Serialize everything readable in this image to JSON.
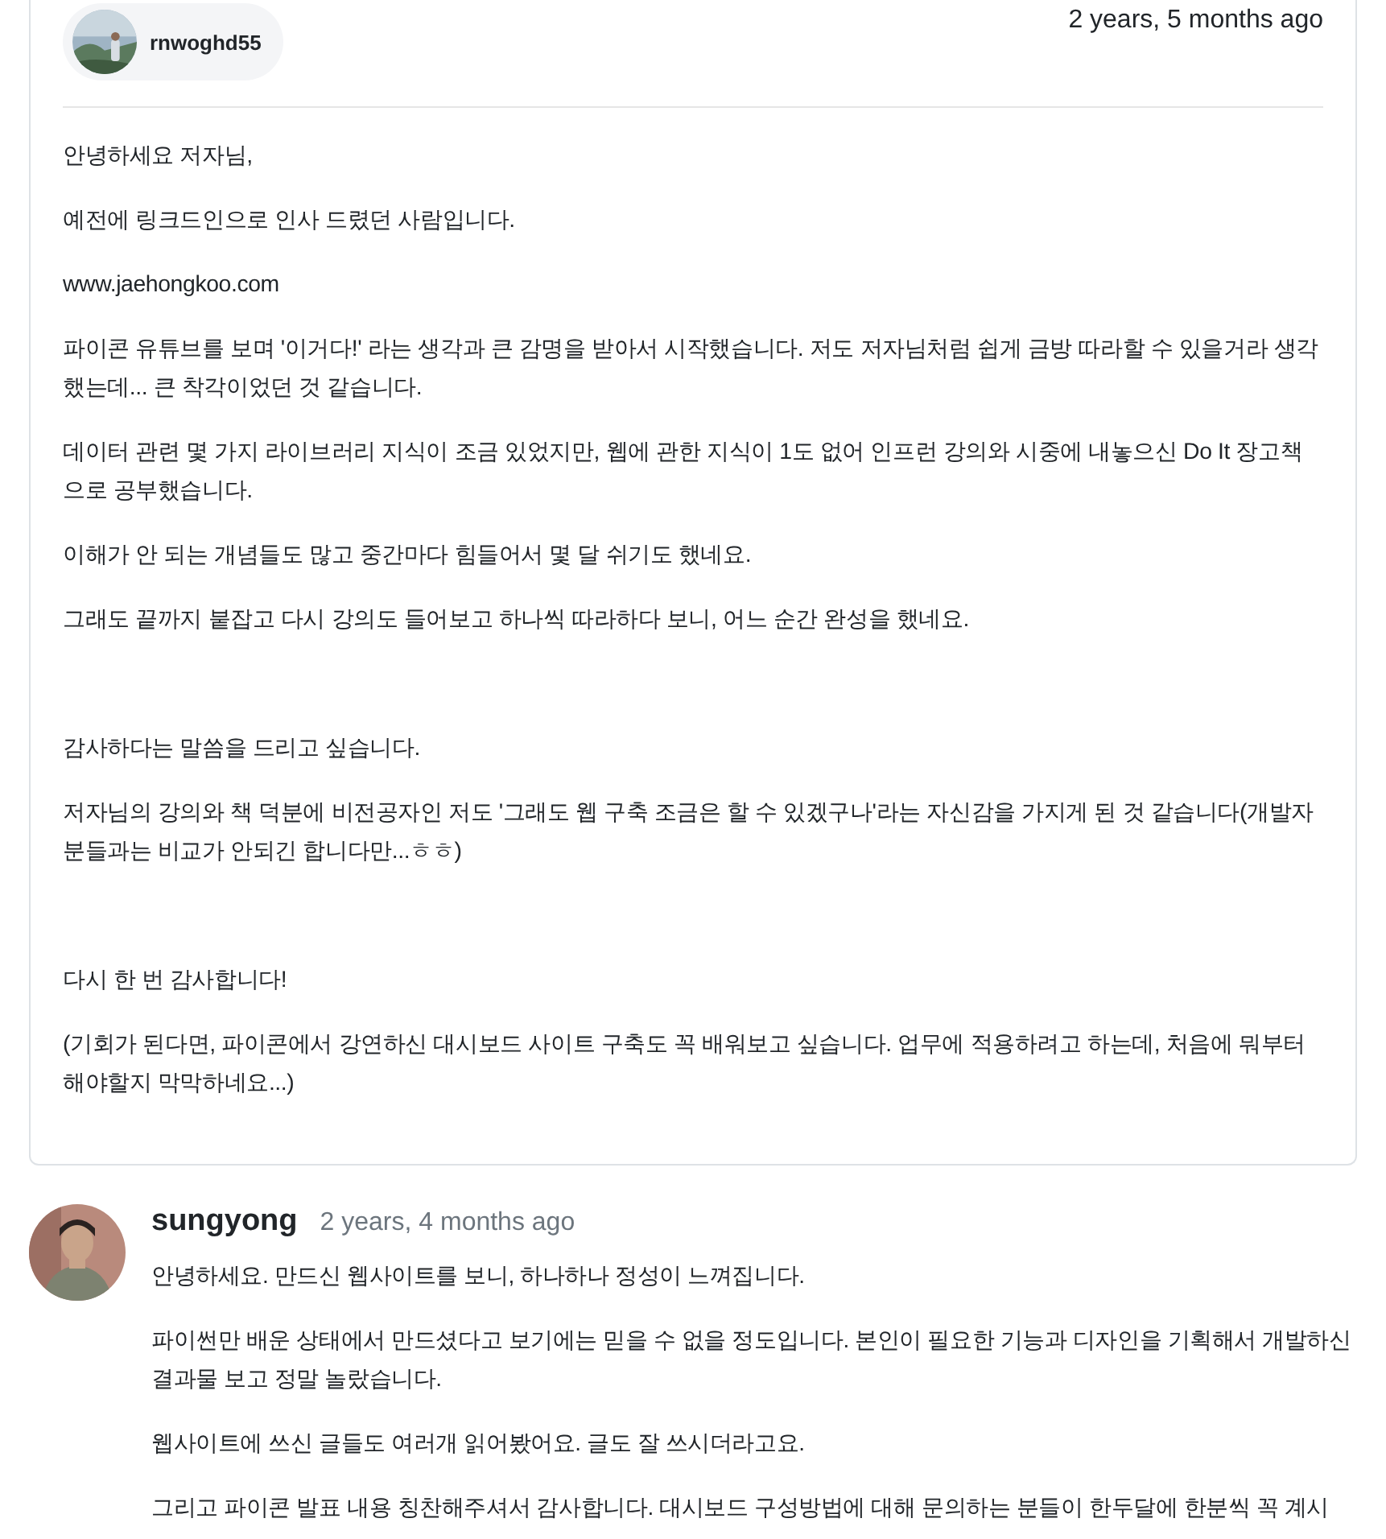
{
  "post": {
    "author": "rnwoghd55",
    "time": "2 years, 5 months ago",
    "sections": [
      [
        "안녕하세요 저자님,",
        "예전에 링크드인으로 인사 드렸던 사람입니다.",
        "www.jaehongkoo.com",
        "파이콘 유튜브를 보며 '이거다!' 라는 생각과 큰 감명을 받아서 시작했습니다. 저도 저자님처럼 쉽게 금방 따라할 수 있을거라 생각했는데... 큰 착각이었던 것 같습니다.",
        "데이터 관련 몇 가지 라이브러리 지식이 조금 있었지만, 웹에 관한 지식이 1도 없어 인프런 강의와 시중에 내놓으신 Do It 장고책으로 공부했습니다.",
        "이해가 안 되는 개념들도 많고 중간마다 힘들어서 몇 달 쉬기도 했네요.",
        "그래도 끝까지 붙잡고 다시 강의도 들어보고 하나씩 따라하다 보니, 어느 순간 완성을 했네요."
      ],
      [
        "감사하다는 말씀을 드리고 싶습니다.",
        "저자님의 강의와 책 덕분에 비전공자인 저도 '그래도 웹 구축 조금은 할 수 있겠구나'라는 자신감을 가지게 된 것 같습니다(개발자분들과는 비교가 안되긴 합니다만...ㅎㅎ)"
      ],
      [
        "다시 한 번 감사합니다!",
        "(기회가 된다면, 파이콘에서 강연하신 대시보드 사이트 구축도 꼭 배워보고 싶습니다. 업무에 적용하려고 하는데, 처음에 뭐부터 해야할지 막막하네요...)"
      ]
    ]
  },
  "reply": {
    "author": "sungyong",
    "time": "2 years, 4 months ago",
    "paragraphs": [
      "안녕하세요. 만드신 웹사이트를 보니, 하나하나 정성이 느껴집니다.",
      "파이썬만 배운 상태에서 만드셨다고 보기에는 믿을 수 없을 정도입니다. 본인이 필요한 기능과 디자인을 기획해서 개발하신 결과물 보고 정말 놀랐습니다.",
      "웹사이트에 쓰신 글들도 여러개 읽어봤어요. 글도 잘 쓰시더라고요.",
      "그리고 파이콘 발표 내용 칭찬해주셔서 감사합니다. 대시보드 구성방법에 대해 문의하는 분들이 한두달에 한분씩 꼭 계시"
    ]
  }
}
